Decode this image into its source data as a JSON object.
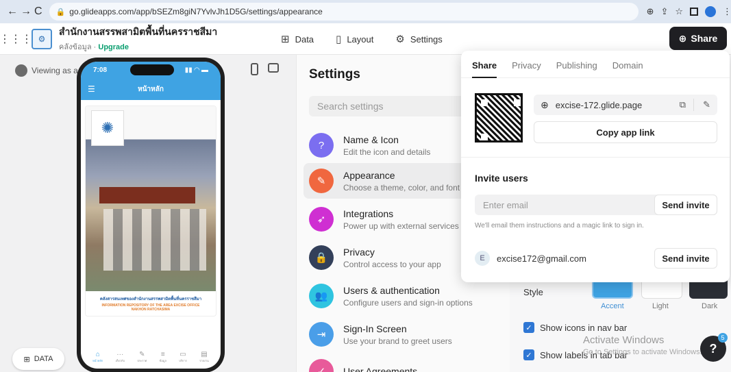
{
  "browser": {
    "url": "go.glideapps.com/app/bSEZm8giN7YvlvJh1D5G/settings/appearance",
    "back": "←",
    "forward": "→",
    "reload": "C"
  },
  "app": {
    "title": "สำนักงานสรรพสามิตพื้นที่นครราชสีมา",
    "sub_prefix": "คลังข้อมูล",
    "upgrade": "Upgrade"
  },
  "top_nav": [
    {
      "label": "Data",
      "icon": "table-icon"
    },
    {
      "label": "Layout",
      "icon": "layout-icon"
    },
    {
      "label": "Settings",
      "icon": "gear-icon"
    }
  ],
  "share_button": "Share",
  "preview": {
    "viewing_as": "Viewing as a",
    "phone_time": "7:08",
    "phone_title": "หน้าหลัก",
    "caption1": "คลังสารสนเทศของสำนักงานสรรพสามิตพื้นที่นครราชสีมา",
    "caption2": "INFORMATION REPOSITORY OF THE AREA EXCISE OFFICE",
    "caption3": "NAKHON RATCHASIMA",
    "tabs": [
      "หน้าหลัก",
      "เกี่ยวกับ",
      "ประกาศ",
      "ข้อมูล",
      "บริการ",
      "รายงาน"
    ],
    "data_button": "DATA"
  },
  "settings": {
    "heading": "Settings",
    "search_placeholder": "Search settings",
    "items": [
      {
        "title": "Name & Icon",
        "desc": "Edit the icon and details",
        "color": "#7b6ef0",
        "icon": "?"
      },
      {
        "title": "Appearance",
        "desc": "Choose a theme, color, and font",
        "color": "#f0673f",
        "icon": "✎"
      },
      {
        "title": "Integrations",
        "desc": "Power up with external services",
        "color": "#cf2fd2",
        "icon": "➶"
      },
      {
        "title": "Privacy",
        "desc": "Control access to your app",
        "color": "#33405a",
        "icon": "🔒"
      },
      {
        "title": "Users & authentication",
        "desc": "Configure users and sign-in options",
        "color": "#2fc4e0",
        "icon": "👥"
      },
      {
        "title": "Sign-In Screen",
        "desc": "Use your brand to greet users",
        "color": "#4a9ee8",
        "icon": "⇥"
      },
      {
        "title": "User Agreements",
        "desc": "",
        "color": "#e85a9a",
        "icon": "✓"
      }
    ]
  },
  "appearance": {
    "style_label": "Style",
    "styles": [
      "Accent",
      "Light",
      "Dark"
    ],
    "check1": "Show icons in nav bar",
    "check2": "Show labels in tab bar",
    "win1": "Activate Windows",
    "win2": "Go to Settings to activate Windows.",
    "help_badge": "5",
    "help_label": "?"
  },
  "share_popover": {
    "tabs": [
      "Share",
      "Privacy",
      "Publishing",
      "Domain"
    ],
    "link": "excise-172.glide.page",
    "copy_label": "Copy app link",
    "invite_title": "Invite users",
    "email_placeholder": "Enter email",
    "send_invite": "Send invite",
    "hint": "We'll email them instructions and a magic link to sign in.",
    "user_initial": "E",
    "user_email": "excise172@gmail.com"
  }
}
